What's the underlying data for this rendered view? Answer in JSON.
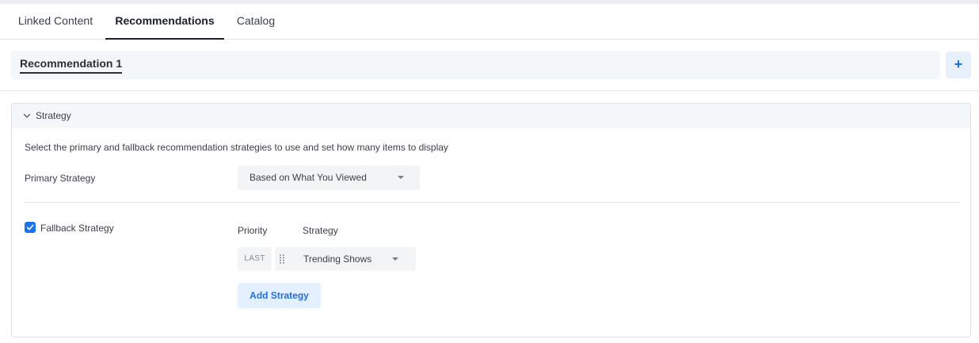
{
  "tabs": [
    {
      "label": "Linked Content",
      "active": false
    },
    {
      "label": "Recommendations",
      "active": true
    },
    {
      "label": "Catalog",
      "active": false
    }
  ],
  "recommendations": {
    "items": [
      {
        "label": "Recommendation 1",
        "active": true
      }
    ],
    "add_button": "+"
  },
  "strategy_panel": {
    "title": "Strategy",
    "expanded": true,
    "description": "Select the primary and fallback recommendation strategies to use and set how many items to display",
    "primary": {
      "label": "Primary Strategy",
      "selected": "Based on What You Viewed"
    },
    "fallback": {
      "label": "Fallback Strategy",
      "checked": true,
      "columns": {
        "priority": "Priority",
        "strategy": "Strategy"
      },
      "rows": [
        {
          "priority": "LAST",
          "strategy": "Trending Shows"
        }
      ],
      "add_button": "Add Strategy"
    }
  },
  "colors": {
    "accent": "#1d6fe0",
    "checkbox": "#1a73e8",
    "header_bg": "#f4f7fa",
    "select_bg": "#f3f4f6"
  },
  "icons": {
    "panel_toggle": "chevron-down-icon",
    "add_recommendation": "plus-icon",
    "drag": "drag-handle-icon",
    "dropdown": "caret-down-icon",
    "check": "checkmark-icon"
  }
}
